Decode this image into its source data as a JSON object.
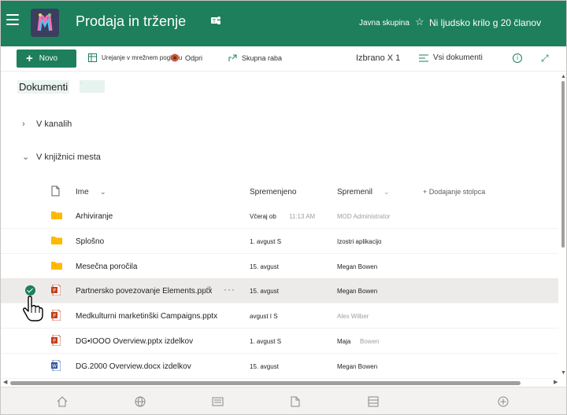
{
  "header": {
    "site_title": "Prodaja in trženje",
    "visibility": "Javna skupina",
    "members": "Ni ljudsko krilo g 20 članov"
  },
  "commands": {
    "new": "Novo",
    "edit_grid": "Urejanje v mrežnem pogledu",
    "open": "Odpri",
    "share": "Skupna raba",
    "selected": "Izbrano X 1",
    "view": "Vsi dokumenti"
  },
  "library": {
    "heading": "Dokumenti",
    "heading_ghost": "...",
    "groups": [
      {
        "label": "V kanalih"
      },
      {
        "label": "V knjižnici mesta"
      }
    ],
    "columns": {
      "name": "Ime",
      "modified": "Spremenjeno",
      "modified_by": "Spremenil",
      "add_column": "Dodajanje stolpca"
    },
    "rows": [
      {
        "name": "Arhiviranje",
        "modified": "Včeraj ob",
        "modified_time": "11:13 AM",
        "by": "MOD Administrator",
        "by2": "",
        "type": "folder"
      },
      {
        "name": "Splošno",
        "modified": "1. avgust S",
        "modified_time": "",
        "by": "Izostri aplikacijo",
        "by2": "",
        "type": "folder"
      },
      {
        "name": "Mesečna poročila",
        "modified": "15. avgust",
        "modified_time": "",
        "by": "Megan Bowen",
        "by2": "",
        "type": "folder"
      },
      {
        "name": "Partnersko povezovanje Elements.pptx",
        "modified": "15. avgust",
        "modified_time": "",
        "by": "Megan Bowen",
        "by2": "",
        "type": "pptx"
      },
      {
        "name": "Medkulturni marketinški Campaigns.pptx",
        "modified": "avgust I S",
        "modified_time": "",
        "by": "Alex Wilber",
        "by2": "",
        "type": "pptx"
      },
      {
        "name": "DG•IOOO Overview.pptx izdelkov",
        "modified": "1. avgust S",
        "modified_time": "",
        "by": "Maja",
        "by2": "Bowen",
        "type": "pptx"
      },
      {
        "name": "DG.2000 Overview.docx izdelkov",
        "modified": "15. avgust",
        "modified_time": "",
        "by": "Megan Bowen",
        "by2": "",
        "type": "docx"
      }
    ]
  },
  "colors": {
    "brand": "#1e7f5c",
    "ppt": "#c43e1c",
    "word": "#2b579a",
    "folder": "#ffb900"
  }
}
